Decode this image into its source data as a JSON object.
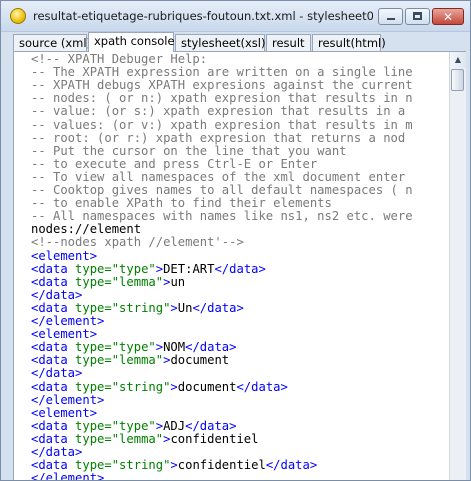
{
  "window": {
    "title": "resultat-etiquetage-rubriques-foutoun.txt.xml - stylesheet01.xs...",
    "close_glyph": "✕"
  },
  "tabs": [
    {
      "label": "source (xml)",
      "active": false
    },
    {
      "label": "xpath console",
      "active": true
    },
    {
      "label": "stylesheet(xsl)",
      "active": false
    },
    {
      "label": "result",
      "active": false
    },
    {
      "label": "result(html)",
      "active": false
    }
  ],
  "scrollbar": {
    "up_glyph": "▲"
  },
  "editor": {
    "lines": [
      [
        {
          "t": "<!-- XPATH Debuger Help:",
          "c": "comment"
        }
      ],
      [
        {
          "t": "-- The XPATH expression are written on a single line",
          "c": "comment"
        }
      ],
      [
        {
          "t": "-- XPATH debugs XPATH expresions against the current",
          "c": "comment"
        }
      ],
      [
        {
          "t": "-- nodes: ( or n:) xpath expresion that results in n",
          "c": "comment"
        }
      ],
      [
        {
          "t": "-- value: (or s:) xpath expresion that results in a",
          "c": "comment"
        }
      ],
      [
        {
          "t": "-- values: (or v:) xpath expresion that results in m",
          "c": "comment"
        }
      ],
      [
        {
          "t": "-- root: (or r:) xpath expresion that returns a nod",
          "c": "comment"
        }
      ],
      [
        {
          "t": "-- Put the cursor on the line that you want",
          "c": "comment"
        }
      ],
      [
        {
          "t": "-- to execute and press Ctrl-E or Enter",
          "c": "comment"
        }
      ],
      [
        {
          "t": "-- To view all namespaces of the xml document enter",
          "c": "comment"
        }
      ],
      [
        {
          "t": "-- Cooktop gives names to all default namespaces ( n",
          "c": "comment"
        }
      ],
      [
        {
          "t": "-- to enable XPath to find their elements",
          "c": "comment"
        }
      ],
      [
        {
          "t": "-- All namespaces with names like ns1, ns2 etc. were",
          "c": "comment"
        }
      ],
      [
        {
          "t": "nodes://element",
          "c": "plain"
        }
      ],
      [
        {
          "t": "<!--nodes xpath //element'-->",
          "c": "comment"
        }
      ],
      [
        {
          "t": "<element>",
          "c": "tag"
        }
      ],
      [
        {
          "t": "<data ",
          "c": "tag"
        },
        {
          "t": "type=",
          "c": "attr"
        },
        {
          "t": "\"type\"",
          "c": "val"
        },
        {
          "t": ">",
          "c": "tag"
        },
        {
          "t": "DET:ART",
          "c": "plain"
        },
        {
          "t": "</data>",
          "c": "tag"
        }
      ],
      [
        {
          "t": "<data ",
          "c": "tag"
        },
        {
          "t": "type=",
          "c": "attr"
        },
        {
          "t": "\"lemma\"",
          "c": "val"
        },
        {
          "t": ">",
          "c": "tag"
        },
        {
          "t": "un",
          "c": "plain"
        }
      ],
      [
        {
          "t": "</data>",
          "c": "tag"
        }
      ],
      [
        {
          "t": "<data ",
          "c": "tag"
        },
        {
          "t": "type=",
          "c": "attr"
        },
        {
          "t": "\"string\"",
          "c": "val"
        },
        {
          "t": ">",
          "c": "tag"
        },
        {
          "t": "Un",
          "c": "plain"
        },
        {
          "t": "</data>",
          "c": "tag"
        }
      ],
      [
        {
          "t": "</element>",
          "c": "tag"
        }
      ],
      [
        {
          "t": "<element>",
          "c": "tag"
        }
      ],
      [
        {
          "t": "<data ",
          "c": "tag"
        },
        {
          "t": "type=",
          "c": "attr"
        },
        {
          "t": "\"type\"",
          "c": "val"
        },
        {
          "t": ">",
          "c": "tag"
        },
        {
          "t": "NOM",
          "c": "plain"
        },
        {
          "t": "</data>",
          "c": "tag"
        }
      ],
      [
        {
          "t": "<data ",
          "c": "tag"
        },
        {
          "t": "type=",
          "c": "attr"
        },
        {
          "t": "\"lemma\"",
          "c": "val"
        },
        {
          "t": ">",
          "c": "tag"
        },
        {
          "t": "document",
          "c": "plain"
        }
      ],
      [
        {
          "t": "</data>",
          "c": "tag"
        }
      ],
      [
        {
          "t": "<data ",
          "c": "tag"
        },
        {
          "t": "type=",
          "c": "attr"
        },
        {
          "t": "\"string\"",
          "c": "val"
        },
        {
          "t": ">",
          "c": "tag"
        },
        {
          "t": "document",
          "c": "plain"
        },
        {
          "t": "</data>",
          "c": "tag"
        }
      ],
      [
        {
          "t": "</element>",
          "c": "tag"
        }
      ],
      [
        {
          "t": "<element>",
          "c": "tag"
        }
      ],
      [
        {
          "t": "<data ",
          "c": "tag"
        },
        {
          "t": "type=",
          "c": "attr"
        },
        {
          "t": "\"type\"",
          "c": "val"
        },
        {
          "t": ">",
          "c": "tag"
        },
        {
          "t": "ADJ",
          "c": "plain"
        },
        {
          "t": "</data>",
          "c": "tag"
        }
      ],
      [
        {
          "t": "<data ",
          "c": "tag"
        },
        {
          "t": "type=",
          "c": "attr"
        },
        {
          "t": "\"lemma\"",
          "c": "val"
        },
        {
          "t": ">",
          "c": "tag"
        },
        {
          "t": "confidentiel",
          "c": "plain"
        }
      ],
      [
        {
          "t": "</data>",
          "c": "tag"
        }
      ],
      [
        {
          "t": "<data ",
          "c": "tag"
        },
        {
          "t": "type=",
          "c": "attr"
        },
        {
          "t": "\"string\"",
          "c": "val"
        },
        {
          "t": ">",
          "c": "tag"
        },
        {
          "t": "confidentiel",
          "c": "plain"
        },
        {
          "t": "</data>",
          "c": "tag"
        }
      ],
      [
        {
          "t": "</element>",
          "c": "tag"
        }
      ]
    ]
  }
}
